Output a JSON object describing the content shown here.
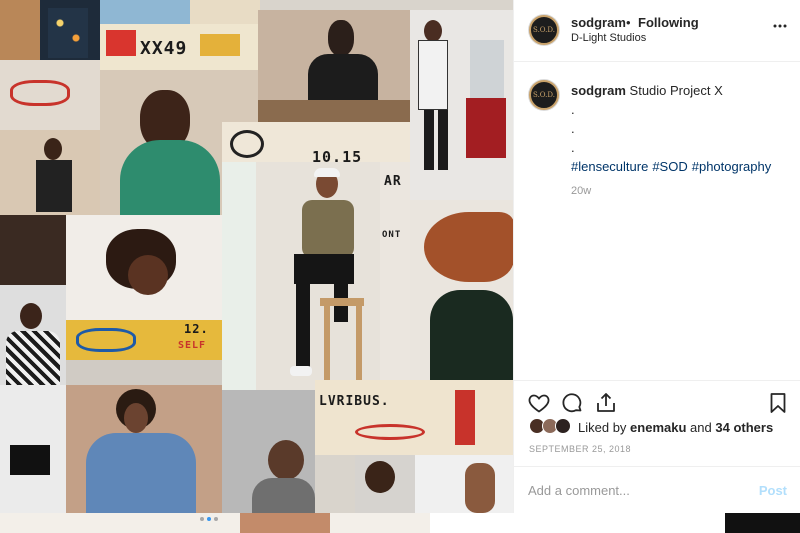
{
  "post": {
    "header": {
      "username": "sodgram",
      "separator": "•",
      "follow_status": "Following",
      "location": "D-Light Studios",
      "avatar_monogram": "S.O.D.",
      "more_icon": "more-horizontal-icon"
    },
    "caption": {
      "username": "sodgram",
      "text": "Studio Project X",
      "lines": [
        ".",
        ".",
        "."
      ],
      "hashtags": [
        "#lenseculture",
        "#SOD",
        "#photography"
      ],
      "age": "20w"
    },
    "actions": {
      "like_icon": "heart-icon",
      "comment_icon": "comment-icon",
      "share_icon": "share-icon",
      "save_icon": "bookmark-icon"
    },
    "likes": {
      "prefix": "Liked by",
      "user": "enemaku",
      "joiner": "and",
      "others": "34 others"
    },
    "date": "SEPTEMBER 25, 2018",
    "comment_box": {
      "placeholder": "Add a comment...",
      "post_label": "Post"
    },
    "collage_text": {
      "scribble_1": "XX49",
      "scribble_2": "10.15",
      "scribble_3": "12.",
      "scribble_4": "SELF",
      "scribble_5": "LVRIBUS.",
      "scribble_6": "AR",
      "scribble_7": "ONT"
    },
    "carousel": {
      "slides": 3,
      "active_index": 1
    },
    "colors": {
      "hashtag": "#003569",
      "post_disabled": "#b2dffc",
      "active_dot": "#3897f0",
      "muted": "#999999"
    }
  }
}
